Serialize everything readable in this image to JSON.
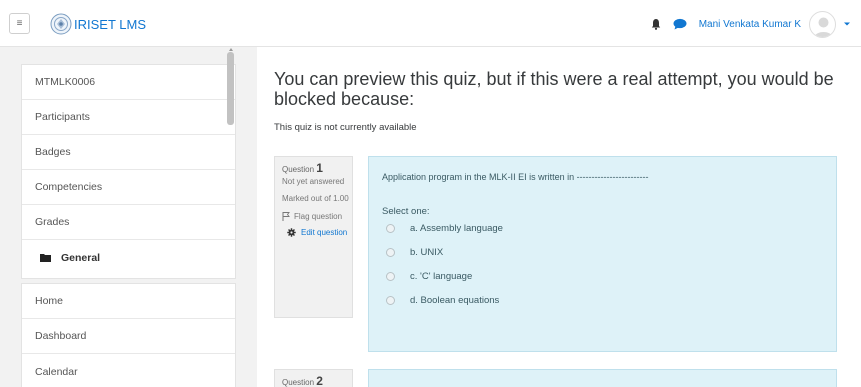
{
  "navbar": {
    "menu_icon": "hamburger-icon",
    "brand": "IRISET LMS",
    "user_name": "Mani Venkata Kumar K"
  },
  "drawer": {
    "course_items": [
      {
        "label": "MTMLK0006"
      },
      {
        "label": "Participants"
      },
      {
        "label": "Badges"
      },
      {
        "label": "Competencies"
      },
      {
        "label": "Grades"
      },
      {
        "label": "General",
        "icon": "folder-icon"
      }
    ],
    "site_items": [
      {
        "label": "Home"
      },
      {
        "label": "Dashboard"
      },
      {
        "label": "Calendar"
      }
    ]
  },
  "main": {
    "title": "You can preview this quiz, but if this were a real attempt, you would be blocked because:",
    "subtitle": "This quiz is not currently available",
    "questions": [
      {
        "label": "Question",
        "number": "1",
        "state": "Not yet answered",
        "mark": "Marked out of 1.00",
        "flag": "Flag question",
        "edit": "Edit question",
        "text": "Application program in the MLK-II EI is written in ------------------------",
        "prompt": "Select one:",
        "answers": [
          "a. Assembly language",
          "b. UNIX",
          "c. 'C' language",
          "d. Boolean equations"
        ]
      },
      {
        "label": "Question",
        "number": "2"
      }
    ]
  },
  "colors": {
    "link": "#1177d1",
    "question_bg": "#def2f8",
    "info_bg": "#f1f1f1"
  }
}
